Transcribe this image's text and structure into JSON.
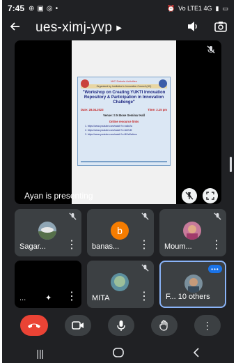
{
  "status": {
    "time": "7:45",
    "net": "Vo LTE1 4G",
    "battery_icon": "battery-icon"
  },
  "header": {
    "title": "ues-ximj-yvp"
  },
  "presentation": {
    "presenter_text": "Ayan is presenting",
    "poster": {
      "org": "MIC Dabnia Activities",
      "band": "Organized by Institution's Innovation Council (IIC)",
      "heading": "\"Workshop on Creating YUKTI Innovation Repository & Participation in Innovation Challenge\"",
      "date": "Date: 28.04.2023",
      "time": "Time: 2.15 pm",
      "venue": "Venue: S N Bose Seminar Hall",
      "links_title": "Online resource links",
      "links": [
        "1. https://www.youtube.com/watch?v=nc6e2a",
        "2. https://www.youtube.com/watch?v=tUrEd5",
        "3. https://www.youtube.com/watch?v=BGaSaAmu"
      ]
    }
  },
  "participants": [
    {
      "name": "Sagar...",
      "type": "photo",
      "muted": true
    },
    {
      "name": "banas...",
      "type": "letter",
      "letter": "b",
      "muted": true
    },
    {
      "name": "Moum...",
      "type": "photo",
      "muted": true
    },
    {
      "name": "...",
      "type": "blank",
      "muted": false
    },
    {
      "name": "MITA",
      "type": "photo",
      "muted": true
    },
    {
      "name": "F... 10 others",
      "type": "photo",
      "muted": false
    }
  ],
  "colors": {
    "end_call": "#ea4335",
    "tile": "#3c4043",
    "background": "#202124",
    "accent": "#8ab4f8"
  }
}
